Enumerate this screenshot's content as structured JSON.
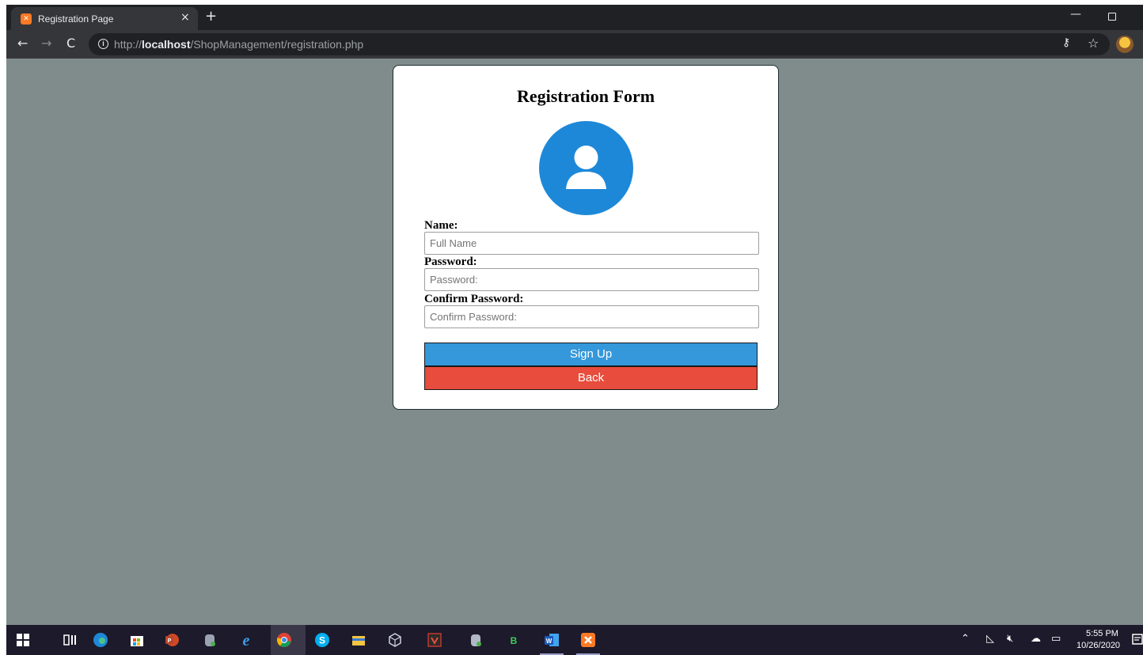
{
  "browser": {
    "tab_title": "Registration Page",
    "tab_close": "×",
    "new_tab": "+",
    "favicon_text": "⌘",
    "url_scheme": "http://",
    "url_host": "localhost",
    "url_path": "/ShopManagement/registration.php"
  },
  "form": {
    "title": "Registration Form",
    "name_label": "Name:",
    "name_placeholder": "Full Name",
    "password_label": "Password:",
    "password_placeholder": "Password:",
    "confirm_label": "Confirm Password:",
    "confirm_placeholder": "Confirm Password:",
    "signup_label": "Sign Up",
    "back_label": "Back",
    "avatar_color": "#1e88d8",
    "signup_color": "#3498db",
    "back_color": "#e74c3c"
  },
  "taskbar": {
    "time": "5:55 PM",
    "date": "10/26/2020",
    "apps": [
      "start-icon",
      "task-view-icon",
      "edge-icon",
      "store-icon",
      "powerpoint-icon",
      "db-icon",
      "ie-icon",
      "chrome-icon",
      "skype-icon",
      "file-explorer-icon",
      "virtualbox-icon",
      "app-v-icon",
      "db2-icon",
      "b-app-icon",
      "word-icon",
      "xampp-icon"
    ]
  }
}
